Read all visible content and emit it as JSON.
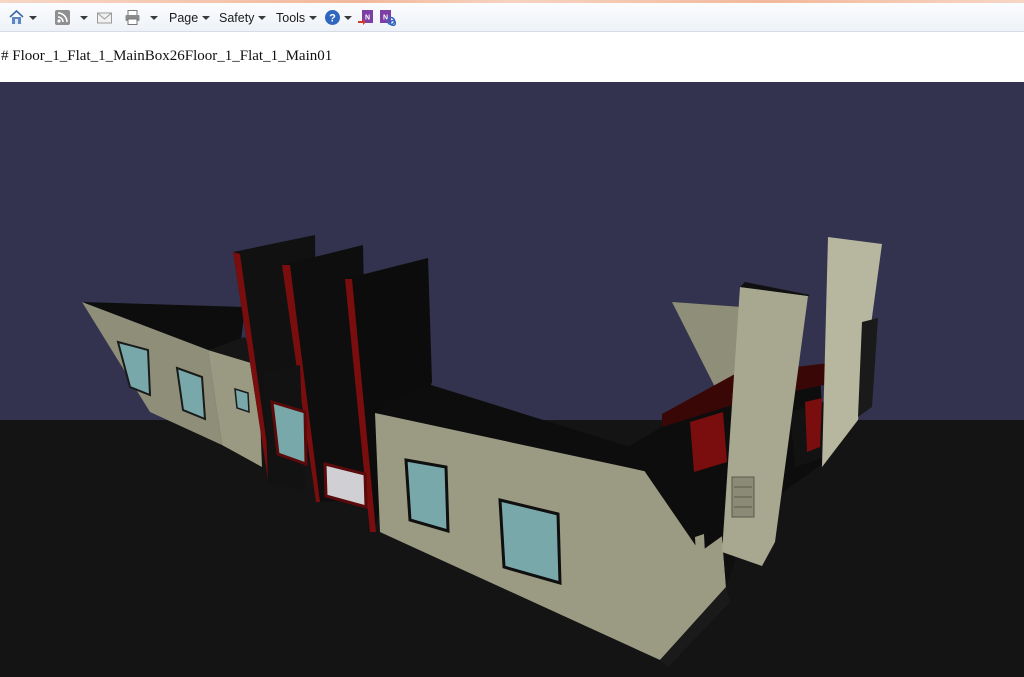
{
  "toolbar": {
    "menus": [
      {
        "label": "Page"
      },
      {
        "label": "Safety"
      },
      {
        "label": "Tools"
      }
    ],
    "icons": [
      "home-icon",
      "feeds-icon",
      "mail-icon",
      "print-icon",
      "help-icon",
      "onenote-send-icon",
      "onenote-linked-icon"
    ]
  },
  "document": {
    "title": "# Floor_1_Flat_1_MainBox26Floor_1_Flat_1_Main01"
  },
  "scene": {
    "sky_color": "#33334f",
    "ground_color": "#141414",
    "wall_color": "#9b9b84",
    "window_color": "#79a8ab",
    "accent_color": "#7a0d0d"
  }
}
